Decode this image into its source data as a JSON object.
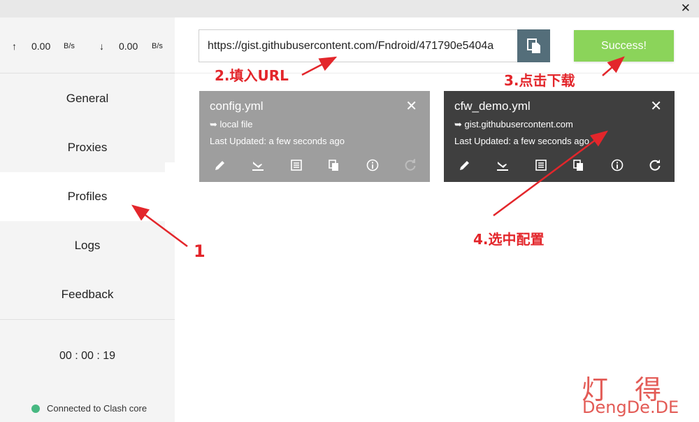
{
  "window": {
    "close_icon": "close-icon"
  },
  "traffic": {
    "up_arrow": "↑",
    "up_value": "0.00",
    "up_unit": "B/s",
    "down_arrow": "↓",
    "down_value": "0.00",
    "down_unit": "B/s"
  },
  "nav": {
    "general": "General",
    "proxies": "Proxies",
    "profiles": "Profiles",
    "logs": "Logs",
    "feedback": "Feedback"
  },
  "timer": "00 : 00 : 19",
  "status": {
    "text": "Connected to Clash core",
    "color": "#47b881"
  },
  "url_input": {
    "value": "https://gist.githubusercontent.com/Fndroid/471790e5404a"
  },
  "download_button": {
    "label": "Success!",
    "color": "#8bd45a"
  },
  "profiles": [
    {
      "title": "config.yml",
      "source": "➥ local file",
      "updated": "Last Updated: a few seconds ago",
      "color": "#9e9e9e"
    },
    {
      "title": "cfw_demo.yml",
      "source": "➥ gist.githubusercontent.com",
      "updated": "Last Updated: a few seconds ago",
      "color": "#3f3f3f"
    }
  ],
  "annotations": {
    "step1": "1",
    "step2": "2.填入URL",
    "step3": "3.点击下载",
    "step4": "4.选中配置",
    "color": "#e3262b"
  },
  "watermark": {
    "cn": "灯得",
    "domain": "DengDe.DE"
  }
}
